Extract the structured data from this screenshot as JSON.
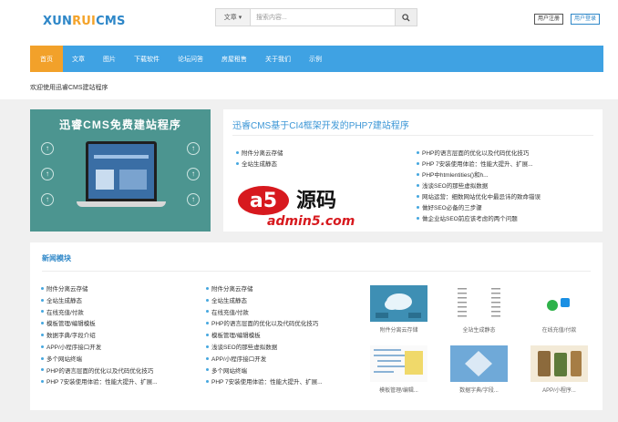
{
  "header": {
    "logo": {
      "part1": "XUN",
      "part2": "RUI",
      "part3": "CMS"
    },
    "search": {
      "category": "文章",
      "placeholder": "搜索内容..."
    },
    "register_label": "用户注册",
    "login_label": "用户登录"
  },
  "nav": {
    "items": [
      "首页",
      "文章",
      "图片",
      "下载软件",
      "论坛问答",
      "房屋租售",
      "关于我们",
      "示例"
    ]
  },
  "welcome": "欢迎使用迅睿CMS建站程序",
  "banner": {
    "title": "迅睿CMS免费建站程序"
  },
  "top_panel": {
    "title": "迅睿CMS基于CI4框架开发的PHP7建站程序",
    "left_list": [
      "附件分离云存储",
      "全站生成静态"
    ],
    "right_list": [
      "PHP的语言层面的优化以及代码优化技巧",
      "PHP 7安装使用体验：性能大提升、扩展...",
      "PHP中htmlentities()和h...",
      "浅谈SEO的那些虚拟数据",
      "网站运营：细数网站优化中最忌讳的致命错误",
      "做好SEO必备的三步骤",
      "做企业站SEO前应该考虑的两个问题"
    ],
    "watermark": {
      "brand": "a5",
      "cn": "源码",
      "site": "admin5.com"
    }
  },
  "news": {
    "title": "新闻模块",
    "col1": [
      "附件分离云存储",
      "全站生成静态",
      "在线充值/付款",
      "模板管理/编辑模板",
      "数据字典/字段介绍",
      "APP/小程序接口开发",
      "多个网站终端",
      "PHP的语言层面的优化以及代码优化技巧",
      "PHP 7安装使用体验：性能大提升、扩展..."
    ],
    "col2": [
      "附件分离云存储",
      "全站生成静态",
      "在线充值/付款",
      "PHP的语言层面的优化以及代码优化技巧",
      "模板管理/编辑模板",
      "浅谈SEO的那些虚拟数据",
      "APP/小程序接口开发",
      "多个网站终端",
      "PHP 7安装使用体验：性能大提升、扩展..."
    ],
    "thumbs": [
      "附件分离云存储",
      "全站生成静态",
      "在线充值/付款",
      "模板管理/编辑...",
      "数据字典/字段...",
      "APP/小程序..."
    ]
  },
  "colors": {
    "accent": "#3fa2e3",
    "active": "#f2a12a",
    "link": "#3b96d6",
    "banner": "#4c9590",
    "watermark_red": "#d7191e"
  }
}
